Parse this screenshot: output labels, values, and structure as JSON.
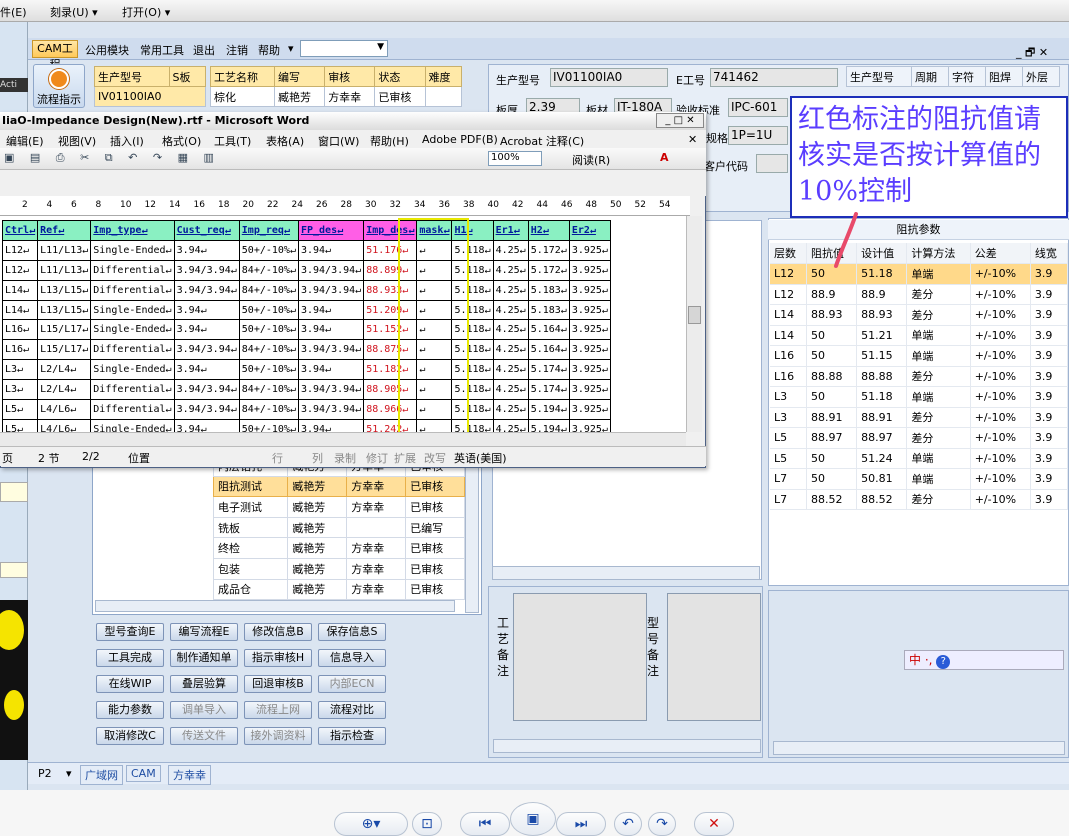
{
  "viewer_menu": {
    "file": "件(E)",
    "burn": "刻录(U) ▾",
    "open": "打开(O) ▾"
  },
  "app": {
    "menu": {
      "cam": "CAM工程",
      "items": [
        "公用模块",
        "常用工具",
        "退出",
        "注销",
        "帮助",
        "▾"
      ],
      "win_controls": "_ 🗗 ✕"
    },
    "flow_button": "流程指示",
    "left_strip_label": "Acti",
    "top_left_table": {
      "headers": [
        "生产型号",
        "S板"
      ],
      "value": "IV01100IA0"
    },
    "process_header": {
      "headers": [
        "工艺名称",
        "编写",
        "审核",
        "状态",
        "难度"
      ],
      "first": [
        "棕化",
        "臧艳芳",
        "方幸幸",
        "已审核"
      ]
    },
    "process_rows": [
      {
        "name": "阻抗测试",
        "writer": "臧艳芳",
        "reviewer": "方幸幸",
        "status": "已审核",
        "selected": true
      },
      {
        "name": "电子测试",
        "writer": "臧艳芳",
        "reviewer": "方幸幸",
        "status": "已审核"
      },
      {
        "name": "铣板",
        "writer": "臧艳芳",
        "reviewer": "",
        "status": "已编写"
      },
      {
        "name": "终检",
        "writer": "臧艳芳",
        "reviewer": "方幸幸",
        "status": "已审核"
      },
      {
        "name": "包装",
        "writer": "臧艳芳",
        "reviewer": "方幸幸",
        "status": "已审核"
      },
      {
        "name": "成品仓",
        "writer": "臧艳芳",
        "reviewer": "方幸幸",
        "status": "已审核"
      }
    ],
    "process_partial_row": [
      "内层钻孔",
      "臧艳芳",
      "方幸幸",
      "已审核"
    ],
    "buttons": [
      [
        "型号查询E",
        "编写流程E",
        "修改信息B",
        "保存信息S"
      ],
      [
        "工具完成",
        "制作通知单",
        "指示审核H",
        "信息导入"
      ],
      [
        "在线WIP",
        "叠层验算",
        "回退审核B",
        "内部ECN"
      ],
      [
        "能力参数",
        "调单导入",
        "流程上网",
        "流程对比"
      ],
      [
        "取消修改C",
        "传送文件",
        "接外调资料",
        "指示检查"
      ]
    ],
    "disabled_buttons": [
      "内部ECN",
      "调单导入",
      "流程上网",
      "传送文件",
      "接外调资料"
    ],
    "info": {
      "model_label": "生产型号",
      "model_value": "IV01100IA0",
      "eno_label": "E工号",
      "eno_value": "741462",
      "thick_label": "板厚",
      "thick_value": "2.39",
      "mat_label": "板材",
      "mat_value": "IT-180A",
      "std_label": "验收标准",
      "std_value": "IPC-601",
      "spec_label": "规格",
      "spec_value": "1P=1U",
      "cust_label": "客户代码",
      "right_headers": [
        "生产型号",
        "周期",
        "字符",
        "阻焊",
        "外层"
      ]
    },
    "remarks": {
      "craft": "工艺备注",
      "model": "型号备注"
    },
    "impedance": {
      "title": "阻抗参数",
      "headers": [
        "层数",
        "阻抗值",
        "设计值",
        "计算方法",
        "公差",
        "线宽"
      ],
      "rows": [
        [
          "L12",
          "50",
          "51.18",
          "单端",
          "+/-10%",
          "3.9"
        ],
        [
          "L12",
          "88.9",
          "88.9",
          "差分",
          "+/-10%",
          "3.9"
        ],
        [
          "L14",
          "88.93",
          "88.93",
          "差分",
          "+/-10%",
          "3.9"
        ],
        [
          "L14",
          "50",
          "51.21",
          "单端",
          "+/-10%",
          "3.9"
        ],
        [
          "L16",
          "50",
          "51.15",
          "单端",
          "+/-10%",
          "3.9"
        ],
        [
          "L16",
          "88.88",
          "88.88",
          "差分",
          "+/-10%",
          "3.9"
        ],
        [
          "L3",
          "50",
          "51.18",
          "单端",
          "+/-10%",
          "3.9"
        ],
        [
          "L3",
          "88.91",
          "88.91",
          "差分",
          "+/-10%",
          "3.9"
        ],
        [
          "L5",
          "88.97",
          "88.97",
          "差分",
          "+/-10%",
          "3.9"
        ],
        [
          "L5",
          "50",
          "51.24",
          "单端",
          "+/-10%",
          "3.9"
        ],
        [
          "L7",
          "50",
          "50.81",
          "单端",
          "+/-10%",
          "3.9"
        ],
        [
          "L7",
          "88.52",
          "88.52",
          "差分",
          "+/-10%",
          "3.9"
        ]
      ]
    },
    "annotation": "红色标注的阻抗值请核实是否按计算值的10%控制",
    "bottom_tabs": [
      "P2",
      "▾",
      "广域网",
      "CAM",
      "方幸幸"
    ],
    "ime": "中 ·,"
  },
  "word": {
    "title": "IiaO-Impedance Design(New).rtf - Microsoft Word",
    "menu": [
      "编辑(E)",
      "视图(V)",
      "插入(I)",
      "格式(O)",
      "工具(T)",
      "表格(A)",
      "窗口(W)",
      "帮助(H)",
      "Adobe PDF(B)",
      "Acrobat 注释(C)"
    ],
    "zoom": "100%",
    "reading": "阅读(R)",
    "ruler": [
      "2",
      "4",
      "6",
      "8",
      "10",
      "12",
      "14",
      "16",
      "18",
      "20",
      "22",
      "24",
      "26",
      "28",
      "30",
      "32",
      "34",
      "36",
      "38",
      "40",
      "42",
      "44",
      "46",
      "48",
      "50",
      "52",
      "54"
    ],
    "headers": [
      "Ctrl↵",
      "Ref↵",
      "Imp_type↵",
      "Cust_req↵",
      "Imp_req↵",
      "FP_des↵",
      "Imp_des↵",
      "mask↵",
      "H1↵",
      "Er1↵",
      "H2↵",
      "Er2↵"
    ],
    "rows": [
      [
        "L12↵",
        "L11/L13↵",
        "Single-Ended↵",
        "3.94↵",
        "50+/-10%↵",
        "3.94↵",
        "51.176↵",
        "↵",
        "5.118↵",
        "4.25↵",
        "5.172↵",
        "3.925↵"
      ],
      [
        "L12↵",
        "L11/L13↵",
        "Differential↵",
        "3.94/3.94↵",
        "84+/-10%↵",
        "3.94/3.94↵",
        "88.899↵",
        "↵",
        "5.118↵",
        "4.25↵",
        "5.172↵",
        "3.925↵"
      ],
      [
        "L14↵",
        "L13/L15↵",
        "Differential↵",
        "3.94/3.94↵",
        "84+/-10%↵",
        "3.94/3.94↵",
        "88.933↵",
        "↵",
        "5.118↵",
        "4.25↵",
        "5.183↵",
        "3.925↵"
      ],
      [
        "L14↵",
        "L13/L15↵",
        "Single-Ended↵",
        "3.94↵",
        "50+/-10%↵",
        "3.94↵",
        "51.209↵",
        "↵",
        "5.118↵",
        "4.25↵",
        "5.183↵",
        "3.925↵"
      ],
      [
        "L16↵",
        "L15/L17↵",
        "Single-Ended↵",
        "3.94↵",
        "50+/-10%↵",
        "3.94↵",
        "51.152↵",
        "↵",
        "5.118↵",
        "4.25↵",
        "5.164↵",
        "3.925↵"
      ],
      [
        "L16↵",
        "L15/L17↵",
        "Differential↵",
        "3.94/3.94↵",
        "84+/-10%↵",
        "3.94/3.94↵",
        "88.875↵",
        "↵",
        "5.118↵",
        "4.25↵",
        "5.164↵",
        "3.925↵"
      ],
      [
        "L3↵",
        "L2/L4↵",
        "Single-Ended↵",
        "3.94↵",
        "50+/-10%↵",
        "3.94↵",
        "51.182↵",
        "↵",
        "5.118↵",
        "4.25↵",
        "5.174↵",
        "3.925↵"
      ],
      [
        "L3↵",
        "L2/L4↵",
        "Differential↵",
        "3.94/3.94↵",
        "84+/-10%↵",
        "3.94/3.94↵",
        "88.905↵",
        "↵",
        "5.118↵",
        "4.25↵",
        "5.174↵",
        "3.925↵"
      ],
      [
        "L5↵",
        "L4/L6↵",
        "Differential↵",
        "3.94/3.94↵",
        "84+/-10%↵",
        "3.94/3.94↵",
        "88.966↵",
        "↵",
        "5.118↵",
        "4.25↵",
        "5.194↵",
        "3.925↵"
      ],
      [
        "L5↵",
        "L4/L6↵",
        "Single-Ended↵",
        "3.94↵",
        "50+/-10%↵",
        "3.94↵",
        "51.242↵",
        "↵",
        "5.118↵",
        "4.25↵",
        "5.194↵",
        "3.925↵"
      ]
    ],
    "status": {
      "page": "页",
      "section": "2 节",
      "pages": "2/2",
      "pos": "位置",
      "line": "行",
      "col": "列",
      "rec": "录制",
      "trk": "修订",
      "ext": "扩展",
      "ovr": "改写",
      "lang": "英语(美国)"
    }
  },
  "viewer_bottom": [
    "⊕▾",
    "⊡",
    "⏮",
    "▣",
    "⏭",
    "↶",
    "↷",
    "✕"
  ]
}
